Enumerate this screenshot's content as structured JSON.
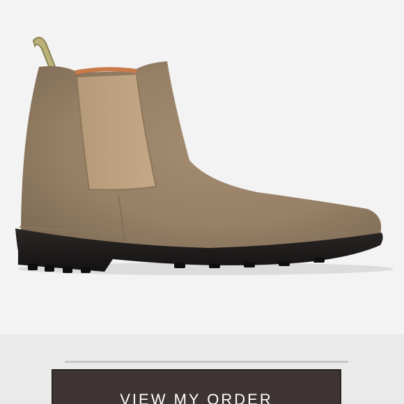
{
  "product": {
    "image_alt": "chelsea-boot-image",
    "boot_color": "#9b8468",
    "sole_color": "#1f1c1b"
  },
  "actions": {
    "view_order_label": "VIEW MY ORDER"
  },
  "colors": {
    "background": "#f2f2f2",
    "button_background": "#3d3433",
    "button_text": "#ffffff",
    "divider": "#c7c7c7"
  }
}
